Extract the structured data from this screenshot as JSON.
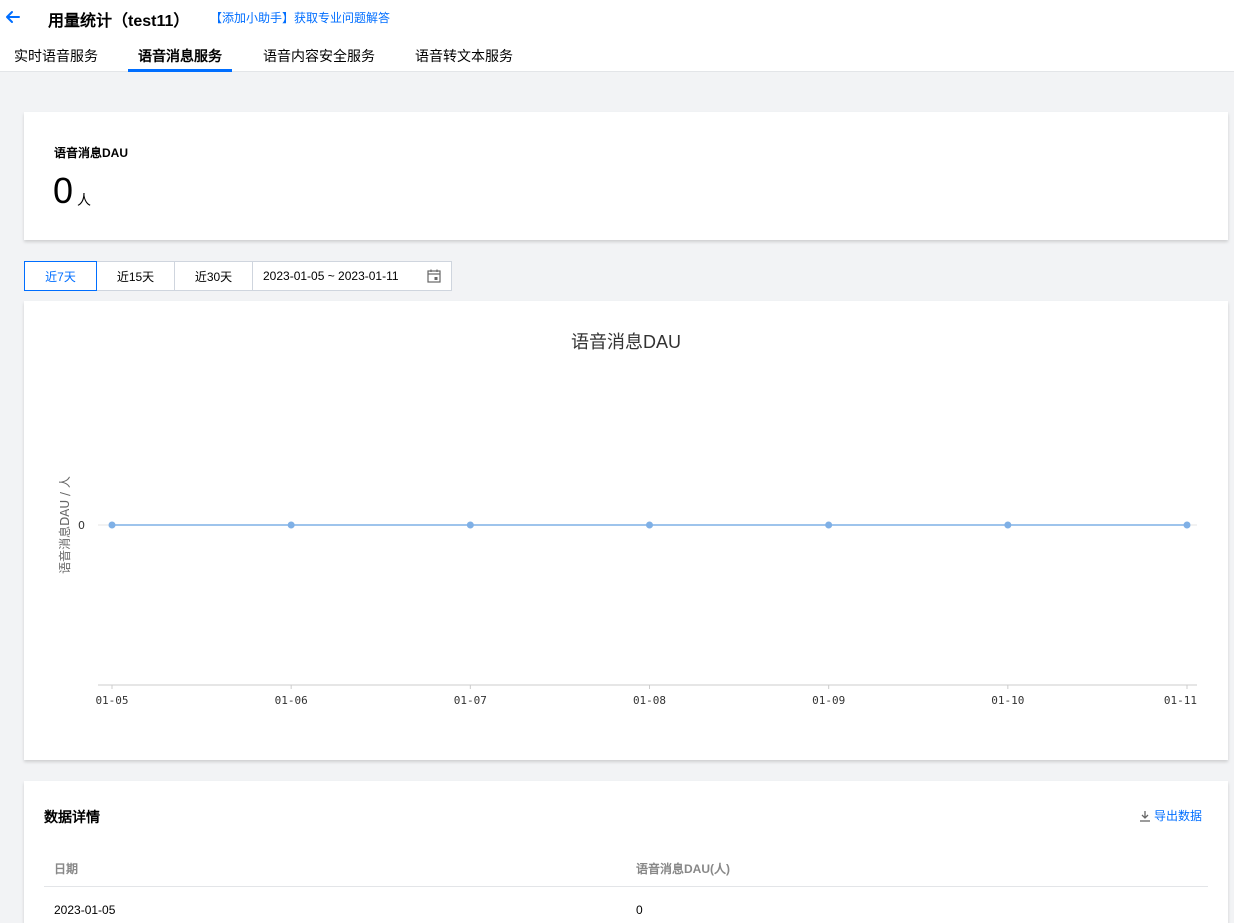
{
  "header": {
    "title": "用量统计（test11）",
    "helper_link": "【添加小助手】获取专业问题解答"
  },
  "tabs": [
    {
      "label": "实时语音服务"
    },
    {
      "label": "语音消息服务",
      "active": true
    },
    {
      "label": "语音内容安全服务"
    },
    {
      "label": "语音转文本服务"
    }
  ],
  "metric": {
    "label": "语音消息DAU",
    "value": "0",
    "unit": "人"
  },
  "date_filter": {
    "options": [
      "近7天",
      "近15天",
      "近30天"
    ],
    "selected": "近7天",
    "range": "2023-01-05 ~ 2023-01-11"
  },
  "chart_data": {
    "type": "line",
    "title": "语音消息DAU",
    "ylabel": "语音消息DAU / 人",
    "xlabel": "",
    "x": [
      "01-05",
      "01-06",
      "01-07",
      "01-08",
      "01-09",
      "01-10",
      "01-11"
    ],
    "series": [
      {
        "values": [
          0,
          0,
          0,
          0,
          0,
          0,
          0
        ]
      }
    ],
    "yticks": [
      "0"
    ],
    "color": "#7fb0e6",
    "grid": false,
    "legend": "none"
  },
  "table": {
    "heading": "数据详情",
    "export_label": "导出数据",
    "columns": [
      "日期",
      "语音消息DAU(人)"
    ],
    "rows": [
      [
        "2023-01-05",
        "0"
      ]
    ]
  },
  "colors": {
    "accent": "#006eff",
    "background": "#f2f3f5",
    "line": "#7fb0e6"
  }
}
